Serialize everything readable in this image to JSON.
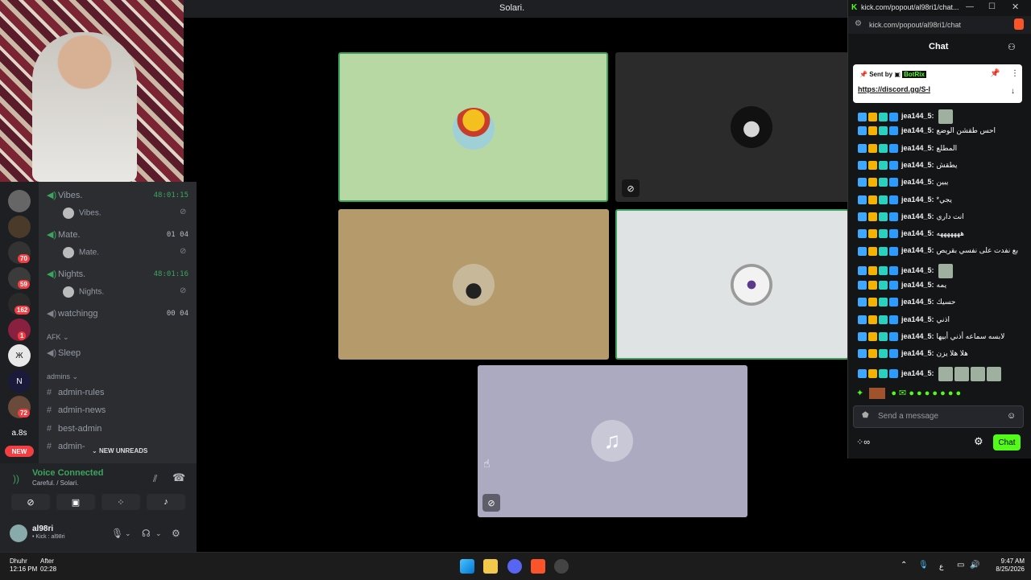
{
  "window": {
    "title": "Solari."
  },
  "channels": {
    "voice": [
      {
        "name": "Vibes.",
        "timer": "48:01:15",
        "member": "Vibes."
      },
      {
        "name": "Mate.",
        "count_a": "01",
        "count_b": "04",
        "member": "Mate."
      },
      {
        "name": "Nights.",
        "timer": "48:01:16",
        "member": "Nights."
      },
      {
        "name": "watchingg",
        "count_a": "00",
        "count_b": "04"
      }
    ],
    "afk_category": "AFK",
    "afk_channel": "Sleep",
    "admins_category": "admins",
    "text": [
      "admin-rules",
      "admin-news",
      "best-admin",
      "admin-"
    ],
    "new_unreads": "NEW UNREADS"
  },
  "rail": {
    "badges": [
      "70",
      "59",
      "162",
      "1",
      "72"
    ],
    "labels": [
      "a.8s",
      "NEW"
    ]
  },
  "voice_panel": {
    "title": "Voice Connected",
    "subtitle": "Careful. / Solari.",
    "username": "al98ri",
    "status": "• Kick : al98ri"
  },
  "chat": {
    "window_title": "kick.com/popout/al98ri1/chat...",
    "url": "kick.com/popout/al98ri1/chat",
    "header": "Chat",
    "pinned_sent_by": "Sent by",
    "pinned_bot": "BotRix",
    "pinned_link": "https://discord.gg/S-l",
    "messages": [
      {
        "user": "jea144_5:",
        "text": ""
      },
      {
        "user": "jea144_5:",
        "text": "احس طقشن الوضع"
      },
      {
        "user": "jea144_5:",
        "text": "المطلع"
      },
      {
        "user": "jea144_5:",
        "text": "يطقش"
      },
      {
        "user": "jea144_5:",
        "text": "يبين"
      },
      {
        "user": "jea144_5:",
        "text": "*يجي"
      },
      {
        "user": "jea144_5:",
        "text": "انت داري"
      },
      {
        "user": "jea144_5:",
        "text": "هههههههه"
      },
      {
        "user": "jea144_5:",
        "text": "بع نفدت على نفسي بقريص"
      },
      {
        "user": "jea144_5:",
        "text": ""
      },
      {
        "user": "jea144_5:",
        "text": "يمه"
      },
      {
        "user": "jea144_5:",
        "text": "حسيك"
      },
      {
        "user": "jea144_5:",
        "text": "اذني"
      },
      {
        "user": "jea144_5:",
        "text": "لابسه سماعه أذني أبيها"
      },
      {
        "user": "jea144_5:",
        "text": "هلا هلا يزن"
      },
      {
        "user": "jea144_5:",
        "text": ""
      }
    ],
    "send_placeholder": "Send a message",
    "chat_button": "Chat"
  },
  "taskbar": {
    "prayer_name": "Dhuhr",
    "prayer_time": "12:16 PM",
    "after_label": "After",
    "after_time": "02:28",
    "lang": "ع",
    "time": "9:47 AM",
    "date": "8/25/2026"
  },
  "colors": {
    "discord_green": "#3ba55d",
    "kick_green": "#53fc18",
    "tile1": "#b8d8a3",
    "tile2": "#2b2b2b",
    "tile3": "#b59a6c",
    "tile4": "#dfe3e4",
    "tile5": "#acaac0"
  }
}
